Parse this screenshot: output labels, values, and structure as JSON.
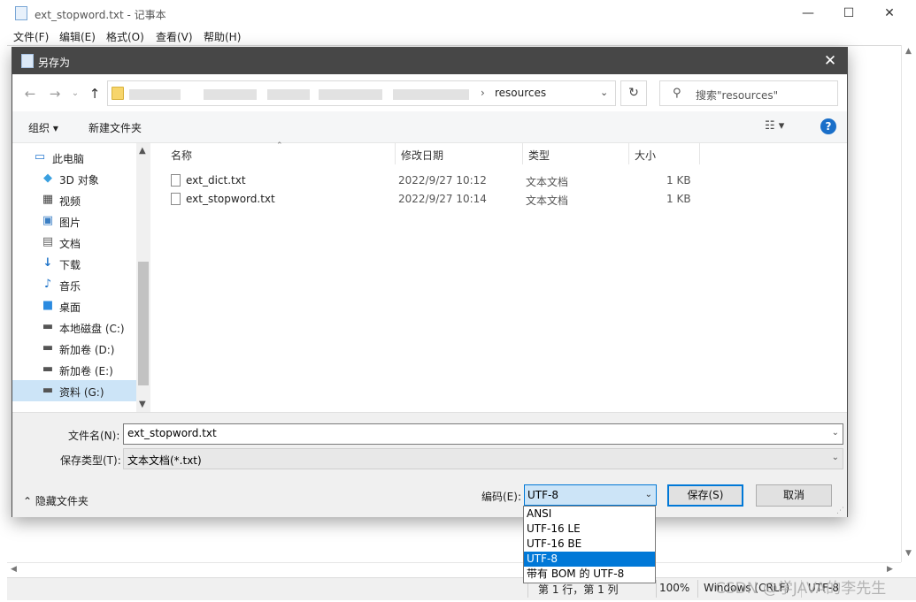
{
  "notepad": {
    "title": "ext_stopword.txt - 记事本",
    "menu": [
      "文件(F)",
      "编辑(E)",
      "格式(O)",
      "查看(V)",
      "帮助(H)"
    ],
    "window_controls": {
      "minimize": "—",
      "maximize": "☐",
      "close": "✕"
    },
    "status": {
      "position": "第 1 行，第 1 列",
      "zoom": "100%",
      "line_ending": "Windows (CRLF)",
      "encoding": "UTF-8"
    }
  },
  "dialog": {
    "title": "另存为",
    "close": "✕",
    "address": {
      "current": "resources",
      "separator": "›"
    },
    "search_placeholder": "搜索\"resources\"",
    "toolbar": {
      "organize": "组织 ▾",
      "new_folder": "新建文件夹",
      "view": "☷ ▾",
      "help": "?"
    },
    "nav": [
      {
        "label": "此电脑",
        "icon": "pc-icon"
      },
      {
        "label": "3D 对象",
        "icon": "cube-icon"
      },
      {
        "label": "视频",
        "icon": "video-icon"
      },
      {
        "label": "图片",
        "icon": "picture-icon"
      },
      {
        "label": "文档",
        "icon": "document-icon"
      },
      {
        "label": "下载",
        "icon": "download-icon"
      },
      {
        "label": "音乐",
        "icon": "music-icon"
      },
      {
        "label": "桌面",
        "icon": "desktop-icon"
      },
      {
        "label": "本地磁盘 (C:)",
        "icon": "drive-icon"
      },
      {
        "label": "新加卷 (D:)",
        "icon": "drive-icon"
      },
      {
        "label": "新加卷 (E:)",
        "icon": "drive-icon"
      },
      {
        "label": "资料 (G:)",
        "icon": "drive-icon",
        "selected": true
      }
    ],
    "columns": [
      "名称",
      "修改日期",
      "类型",
      "大小"
    ],
    "files": [
      {
        "name": "ext_dict.txt",
        "date": "2022/9/27 10:12",
        "type": "文本文档",
        "size": "1 KB"
      },
      {
        "name": "ext_stopword.txt",
        "date": "2022/9/27 10:14",
        "type": "文本文档",
        "size": "1 KB"
      }
    ],
    "filename_label": "文件名(N):",
    "filename_value": "ext_stopword.txt",
    "filetype_label": "保存类型(T):",
    "filetype_value": "文本文档(*.txt)",
    "hide_folders": "隐藏文件夹",
    "encoding_label": "编码(E):",
    "encoding_value": "UTF-8",
    "encoding_options": [
      "ANSI",
      "UTF-16 LE",
      "UTF-16 BE",
      "UTF-8",
      "带有 BOM 的 UTF-8"
    ],
    "encoding_selected_index": 3,
    "save": "保存(S)",
    "cancel": "取消"
  },
  "watermark": "CSDN @学JAVA的李先生"
}
